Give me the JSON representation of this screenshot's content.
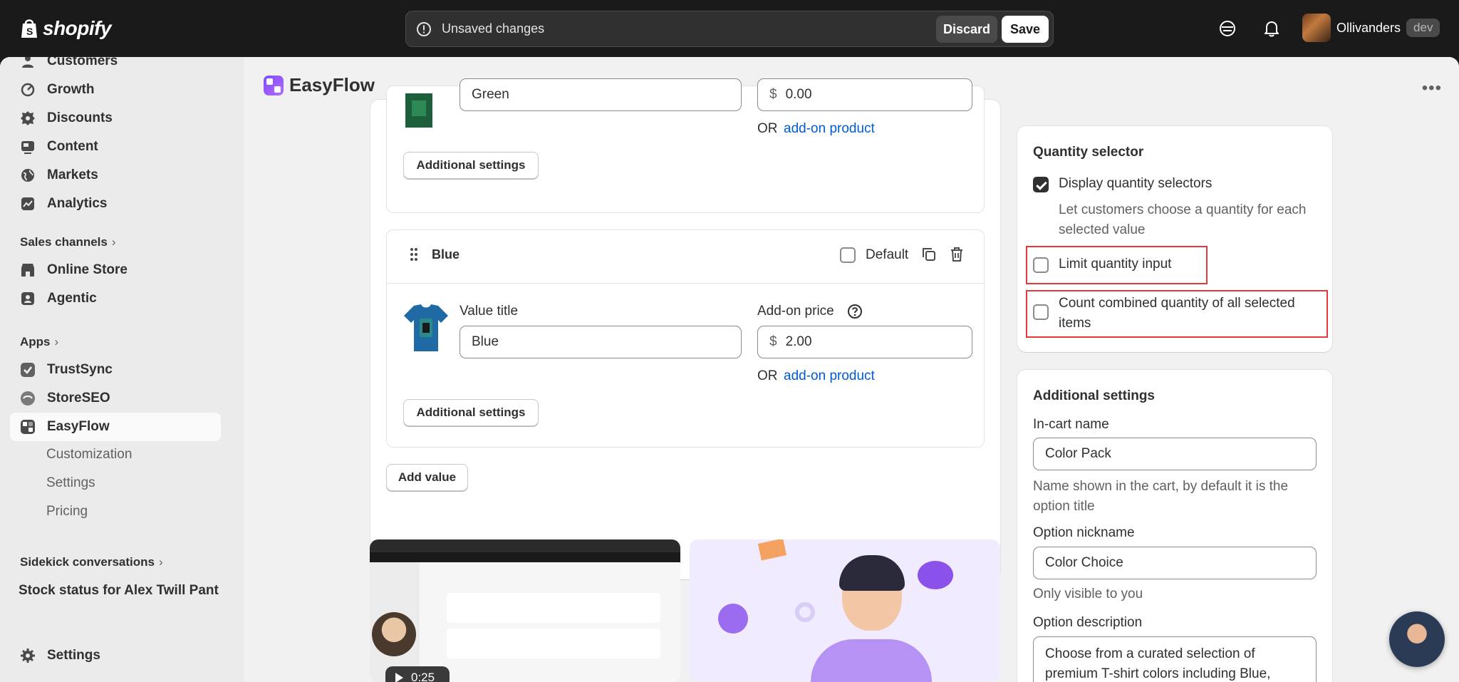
{
  "topbar": {
    "logo_text": "shopify",
    "unsaved_message": "Unsaved changes",
    "discard_label": "Discard",
    "save_label": "Save",
    "store_name": "Ollivanders",
    "store_badge": "dev"
  },
  "sidebar": {
    "items": [
      {
        "label": "Customers",
        "icon": "person-icon"
      },
      {
        "label": "Growth",
        "icon": "growth-icon"
      },
      {
        "label": "Discounts",
        "icon": "discount-icon"
      },
      {
        "label": "Content",
        "icon": "content-icon"
      },
      {
        "label": "Markets",
        "icon": "globe-icon"
      },
      {
        "label": "Analytics",
        "icon": "analytics-icon"
      }
    ],
    "sales_channels_label": "Sales channels",
    "sales_channels": [
      {
        "label": "Online Store",
        "icon": "store-icon"
      },
      {
        "label": "Agentic",
        "icon": "agentic-icon"
      }
    ],
    "apps_label": "Apps",
    "apps": [
      {
        "label": "TrustSync",
        "icon": "trustsync-icon"
      },
      {
        "label": "StoreSEO",
        "icon": "storeseo-icon"
      },
      {
        "label": "EasyFlow",
        "icon": "easyflow-icon"
      }
    ],
    "easyflow_sub": [
      "Customization",
      "Settings",
      "Pricing"
    ],
    "sidekick_label": "Sidekick conversations",
    "sidekick_item": "Stock status for Alex Twill Pant",
    "settings_label": "Settings"
  },
  "app": {
    "title": "EasyFlow"
  },
  "values": {
    "green": {
      "title_value": "Green",
      "price_prefix": "$",
      "price_value": "0.00",
      "or_text": "OR",
      "addon_link": "add-on product",
      "additional_settings": "Additional settings"
    },
    "blue": {
      "name": "Blue",
      "default_label": "Default",
      "value_title_label": "Value title",
      "addon_price_label": "Add-on price",
      "title_value": "Blue",
      "price_prefix": "$",
      "price_value": "2.00",
      "or_text": "OR",
      "addon_link": "add-on product",
      "additional_settings": "Additional settings"
    },
    "add_value_label": "Add value"
  },
  "video": {
    "duration": "0:25"
  },
  "quantity_selector": {
    "heading": "Quantity selector",
    "display_label": "Display quantity selectors",
    "display_checked": true,
    "display_help": "Let customers choose a quantity for each selected value",
    "limit_label": "Limit quantity input",
    "limit_checked": false,
    "combined_label": "Count combined quantity of all selected items",
    "combined_checked": false
  },
  "additional_settings": {
    "heading": "Additional settings",
    "incart_label": "In-cart name",
    "incart_value": "Color Pack",
    "incart_help": "Name shown in the cart, by default it is the option title",
    "nickname_label": "Option nickname",
    "nickname_value": "Color Choice",
    "nickname_help": "Only visible to you",
    "description_label": "Option description",
    "description_value": "Choose from a curated selection of premium T-shirt colors including Blue,"
  },
  "colors": {
    "accent_link": "#005bd3",
    "highlight": "#e5393e",
    "topbar_bg": "#1a1a1a"
  }
}
